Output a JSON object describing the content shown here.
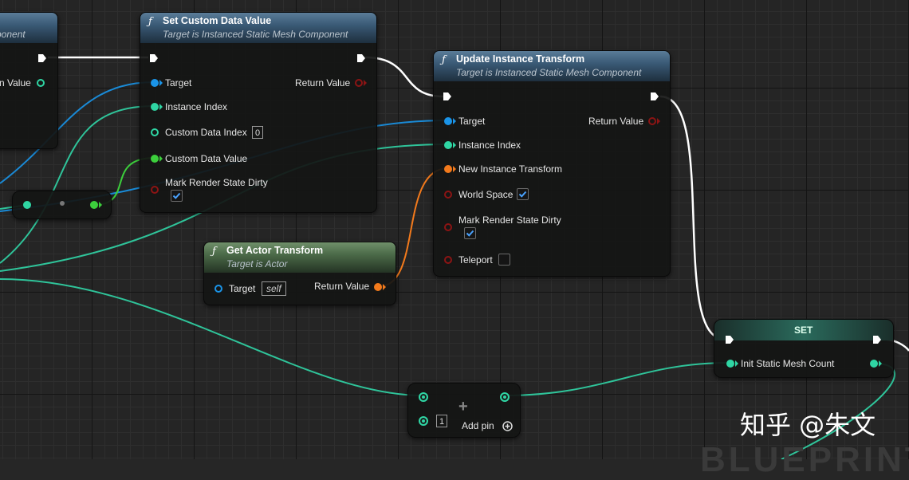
{
  "nodes": {
    "left_partial": {
      "subtitle_fragment": "ponent",
      "return_fragment": "n Value"
    },
    "set_custom_data": {
      "title": "Set Custom Data Value",
      "subtitle": "Target is Instanced Static Mesh Component",
      "pins": {
        "target": "Target",
        "instance_index": "Instance Index",
        "custom_data_index": "Custom Data Index",
        "custom_data_index_value": "0",
        "custom_data_value": "Custom Data Value",
        "mark_render_state_dirty": "Mark Render State Dirty",
        "return_value": "Return Value"
      },
      "mark_render_state_dirty_checked": true
    },
    "update_instance_transform": {
      "title": "Update Instance Transform",
      "subtitle": "Target is Instanced Static Mesh Component",
      "pins": {
        "target": "Target",
        "instance_index": "Instance Index",
        "new_instance_transform": "New Instance Transform",
        "world_space": "World Space",
        "mark_render_state_dirty": "Mark Render State Dirty",
        "teleport": "Teleport",
        "return_value": "Return Value"
      },
      "world_space_checked": true,
      "mark_render_state_dirty_checked": true,
      "teleport_checked": false
    },
    "get_actor_transform": {
      "title": "Get Actor Transform",
      "subtitle": "Target is Actor",
      "pins": {
        "target": "Target",
        "target_default": "self",
        "return_value": "Return Value"
      }
    },
    "set_node": {
      "title": "SET",
      "variable": "Init Static Mesh Count"
    },
    "add_node": {
      "operator": "+",
      "second_input_value": "1",
      "add_pin_label": "Add pin"
    }
  },
  "watermark": "知乎 @朱文",
  "background_text": "BLUEPRINT",
  "colors": {
    "exec": "#ffffff",
    "object_ref": "#1a94e8",
    "integer": "#2fd6a4",
    "float": "#3ccf3c",
    "transform": "#f37a1c",
    "boolean": "#8c1414",
    "function_header": "#3a5a76",
    "pure_header": "#4b6a48"
  }
}
